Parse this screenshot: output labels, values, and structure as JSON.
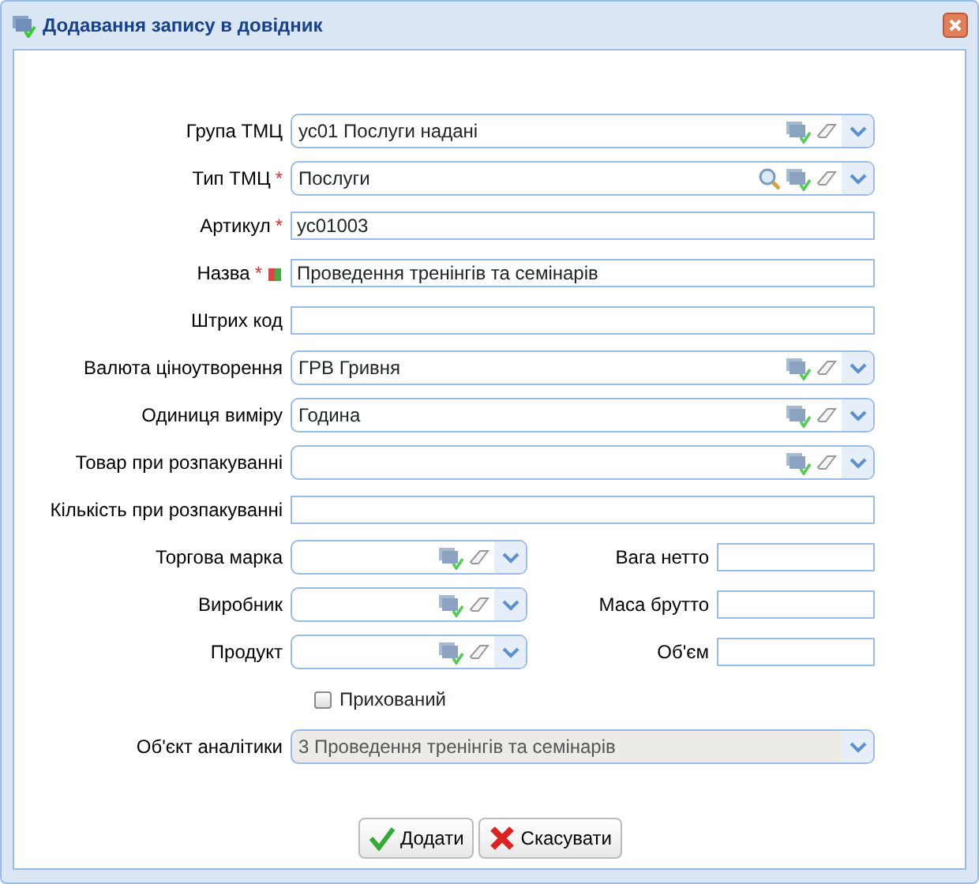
{
  "window": {
    "title": "Додавання запису в довідник"
  },
  "fields": [
    {
      "label": "Група ТМЦ",
      "kind": "combo",
      "value": "ус01 Послуги надані"
    },
    {
      "label": "Тип ТМЦ",
      "required_mark": "*",
      "kind": "combo_search",
      "value": "Послуги"
    },
    {
      "label": "Артикул",
      "required_mark": "*",
      "kind": "text",
      "value": "ус01003"
    },
    {
      "label": "Назва",
      "required_mark": "*",
      "kind": "text_translate",
      "value": "Проведення тренінгів та семінарів"
    },
    {
      "label": "Штрих код",
      "kind": "text"
    },
    {
      "label": "Валюта ціноутворення",
      "kind": "combo",
      "value": "ГРВ Гривня"
    },
    {
      "label": "Одиниця виміру",
      "kind": "combo",
      "value": "Година"
    },
    {
      "label": "Товар при розпакуванні",
      "kind": "combo"
    },
    {
      "label": "Кількість при розпакуванні",
      "kind": "text"
    }
  ],
  "pairs": [
    {
      "left": {
        "label": "Торгова марка"
      },
      "right": {
        "label": "Вага нетто"
      }
    },
    {
      "left": {
        "label": "Виробник"
      },
      "right": {
        "label": "Маса брутто"
      }
    },
    {
      "left": {
        "label": "Продукт"
      },
      "right": {
        "label": "Об'єм"
      }
    }
  ],
  "checkbox": {
    "label": "Прихований",
    "checked": false
  },
  "analytics": {
    "label": "Об'єкт аналітики",
    "value": "3 Проведення тренінгів та семінарів",
    "disabled": true
  },
  "buttons": [
    {
      "label": "Додати",
      "kind": "ok"
    },
    {
      "label": "Скасувати",
      "kind": "cancel"
    }
  ]
}
